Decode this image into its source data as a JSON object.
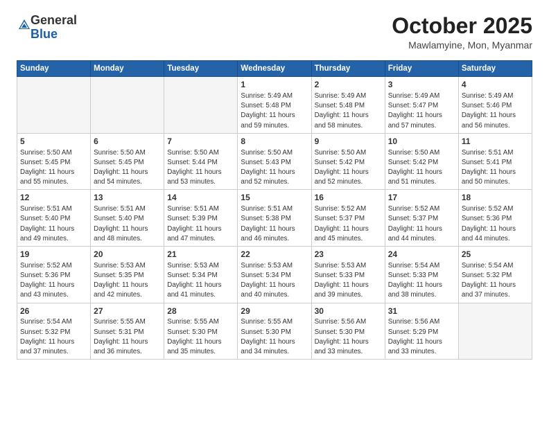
{
  "header": {
    "logo_general": "General",
    "logo_blue": "Blue",
    "month_title": "October 2025",
    "subtitle": "Mawlamyine, Mon, Myanmar"
  },
  "days_of_week": [
    "Sunday",
    "Monday",
    "Tuesday",
    "Wednesday",
    "Thursday",
    "Friday",
    "Saturday"
  ],
  "weeks": [
    [
      {
        "day": "",
        "info": ""
      },
      {
        "day": "",
        "info": ""
      },
      {
        "day": "",
        "info": ""
      },
      {
        "day": "1",
        "info": "Sunrise: 5:49 AM\nSunset: 5:48 PM\nDaylight: 11 hours\nand 59 minutes."
      },
      {
        "day": "2",
        "info": "Sunrise: 5:49 AM\nSunset: 5:48 PM\nDaylight: 11 hours\nand 58 minutes."
      },
      {
        "day": "3",
        "info": "Sunrise: 5:49 AM\nSunset: 5:47 PM\nDaylight: 11 hours\nand 57 minutes."
      },
      {
        "day": "4",
        "info": "Sunrise: 5:49 AM\nSunset: 5:46 PM\nDaylight: 11 hours\nand 56 minutes."
      }
    ],
    [
      {
        "day": "5",
        "info": "Sunrise: 5:50 AM\nSunset: 5:45 PM\nDaylight: 11 hours\nand 55 minutes."
      },
      {
        "day": "6",
        "info": "Sunrise: 5:50 AM\nSunset: 5:45 PM\nDaylight: 11 hours\nand 54 minutes."
      },
      {
        "day": "7",
        "info": "Sunrise: 5:50 AM\nSunset: 5:44 PM\nDaylight: 11 hours\nand 53 minutes."
      },
      {
        "day": "8",
        "info": "Sunrise: 5:50 AM\nSunset: 5:43 PM\nDaylight: 11 hours\nand 52 minutes."
      },
      {
        "day": "9",
        "info": "Sunrise: 5:50 AM\nSunset: 5:42 PM\nDaylight: 11 hours\nand 52 minutes."
      },
      {
        "day": "10",
        "info": "Sunrise: 5:50 AM\nSunset: 5:42 PM\nDaylight: 11 hours\nand 51 minutes."
      },
      {
        "day": "11",
        "info": "Sunrise: 5:51 AM\nSunset: 5:41 PM\nDaylight: 11 hours\nand 50 minutes."
      }
    ],
    [
      {
        "day": "12",
        "info": "Sunrise: 5:51 AM\nSunset: 5:40 PM\nDaylight: 11 hours\nand 49 minutes."
      },
      {
        "day": "13",
        "info": "Sunrise: 5:51 AM\nSunset: 5:40 PM\nDaylight: 11 hours\nand 48 minutes."
      },
      {
        "day": "14",
        "info": "Sunrise: 5:51 AM\nSunset: 5:39 PM\nDaylight: 11 hours\nand 47 minutes."
      },
      {
        "day": "15",
        "info": "Sunrise: 5:51 AM\nSunset: 5:38 PM\nDaylight: 11 hours\nand 46 minutes."
      },
      {
        "day": "16",
        "info": "Sunrise: 5:52 AM\nSunset: 5:37 PM\nDaylight: 11 hours\nand 45 minutes."
      },
      {
        "day": "17",
        "info": "Sunrise: 5:52 AM\nSunset: 5:37 PM\nDaylight: 11 hours\nand 44 minutes."
      },
      {
        "day": "18",
        "info": "Sunrise: 5:52 AM\nSunset: 5:36 PM\nDaylight: 11 hours\nand 44 minutes."
      }
    ],
    [
      {
        "day": "19",
        "info": "Sunrise: 5:52 AM\nSunset: 5:36 PM\nDaylight: 11 hours\nand 43 minutes."
      },
      {
        "day": "20",
        "info": "Sunrise: 5:53 AM\nSunset: 5:35 PM\nDaylight: 11 hours\nand 42 minutes."
      },
      {
        "day": "21",
        "info": "Sunrise: 5:53 AM\nSunset: 5:34 PM\nDaylight: 11 hours\nand 41 minutes."
      },
      {
        "day": "22",
        "info": "Sunrise: 5:53 AM\nSunset: 5:34 PM\nDaylight: 11 hours\nand 40 minutes."
      },
      {
        "day": "23",
        "info": "Sunrise: 5:53 AM\nSunset: 5:33 PM\nDaylight: 11 hours\nand 39 minutes."
      },
      {
        "day": "24",
        "info": "Sunrise: 5:54 AM\nSunset: 5:33 PM\nDaylight: 11 hours\nand 38 minutes."
      },
      {
        "day": "25",
        "info": "Sunrise: 5:54 AM\nSunset: 5:32 PM\nDaylight: 11 hours\nand 37 minutes."
      }
    ],
    [
      {
        "day": "26",
        "info": "Sunrise: 5:54 AM\nSunset: 5:32 PM\nDaylight: 11 hours\nand 37 minutes."
      },
      {
        "day": "27",
        "info": "Sunrise: 5:55 AM\nSunset: 5:31 PM\nDaylight: 11 hours\nand 36 minutes."
      },
      {
        "day": "28",
        "info": "Sunrise: 5:55 AM\nSunset: 5:30 PM\nDaylight: 11 hours\nand 35 minutes."
      },
      {
        "day": "29",
        "info": "Sunrise: 5:55 AM\nSunset: 5:30 PM\nDaylight: 11 hours\nand 34 minutes."
      },
      {
        "day": "30",
        "info": "Sunrise: 5:56 AM\nSunset: 5:30 PM\nDaylight: 11 hours\nand 33 minutes."
      },
      {
        "day": "31",
        "info": "Sunrise: 5:56 AM\nSunset: 5:29 PM\nDaylight: 11 hours\nand 33 minutes."
      },
      {
        "day": "",
        "info": ""
      }
    ]
  ]
}
